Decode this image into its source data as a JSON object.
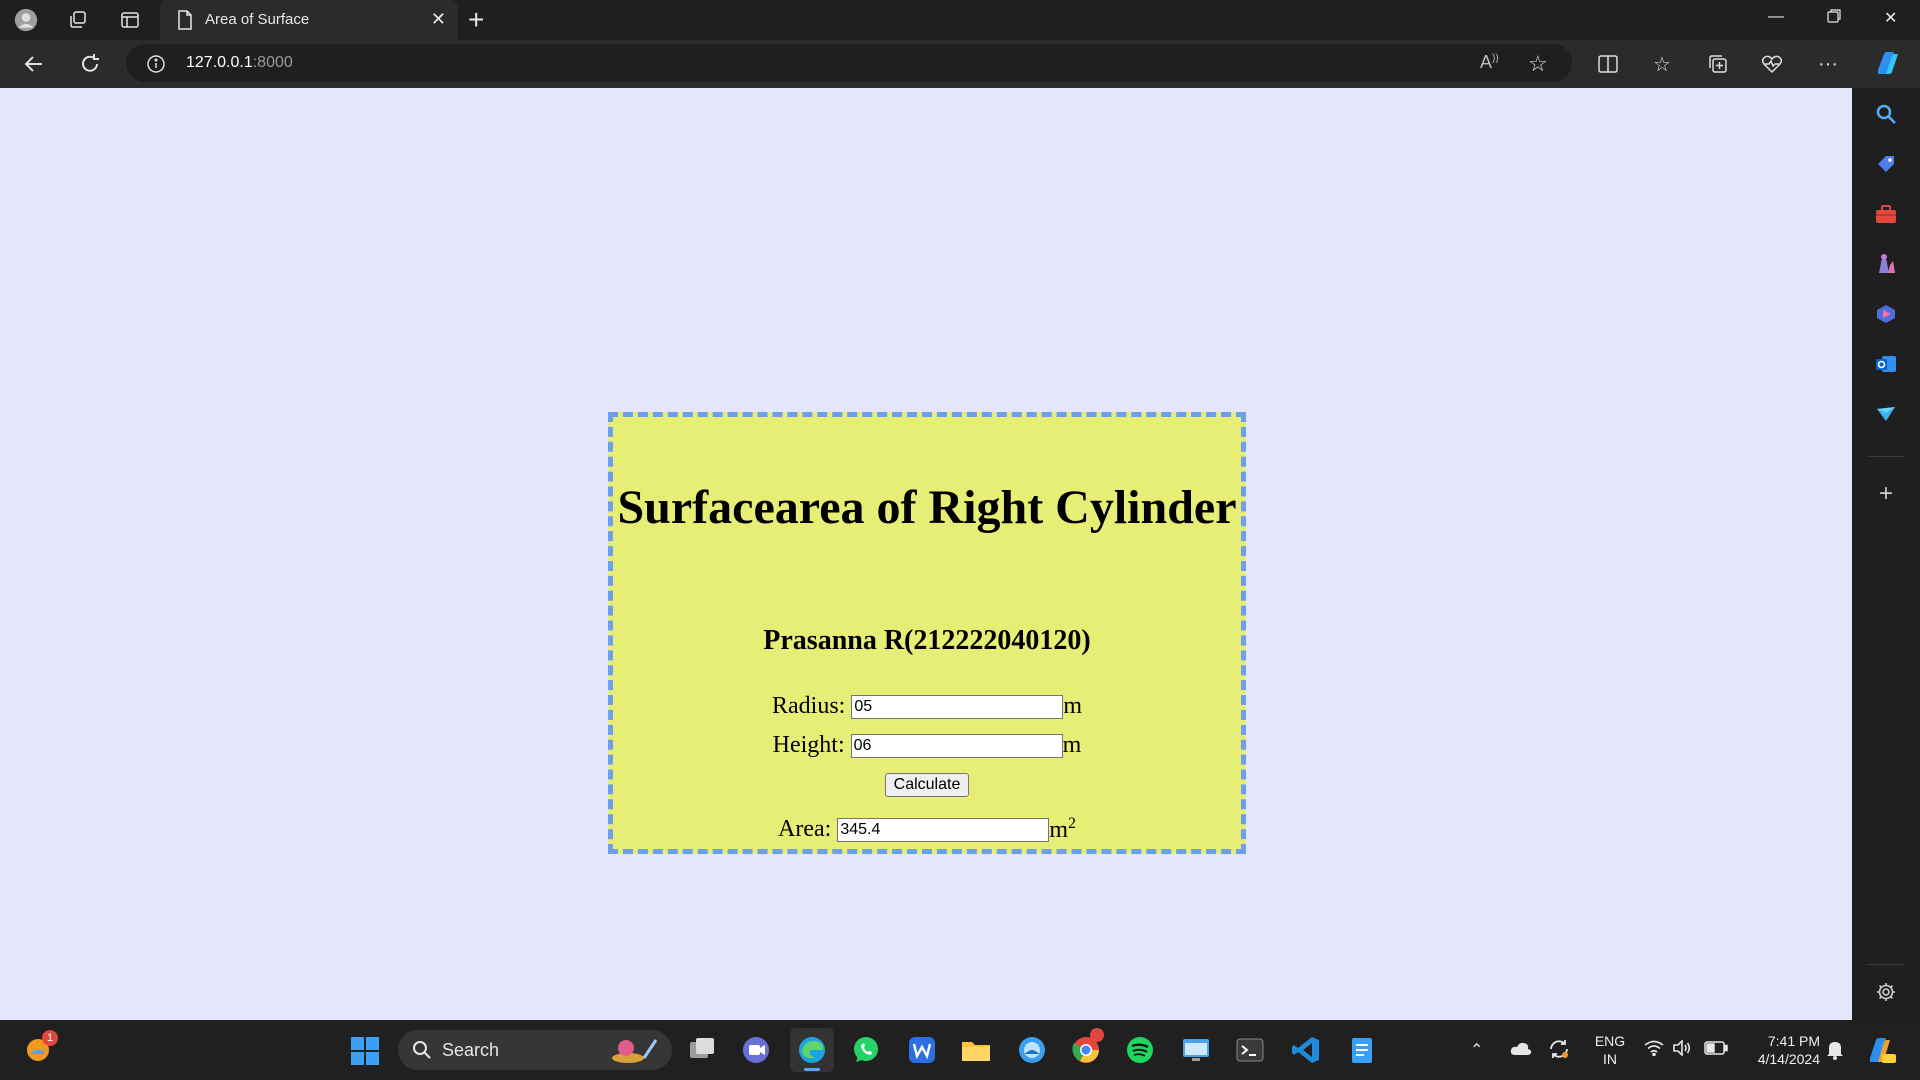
{
  "browser": {
    "tab_title": "Area of Surface",
    "url_host": "127.0.0.1",
    "url_port": ":8000"
  },
  "page": {
    "heading": "Surfacearea of Right Cylinder",
    "author": "Prasanna R(212222040120)",
    "radius_label": "Radius:",
    "radius_value": "05",
    "height_label": "Height:",
    "height_value": "06",
    "unit_m": "m",
    "calculate_label": "Calculate",
    "area_label": "Area:",
    "area_value": "345.4",
    "area_unit": "m",
    "area_exp": "2"
  },
  "taskbar": {
    "search_label": "Search",
    "lang_line1": "ENG",
    "lang_line2": "IN",
    "time": "7:41 PM",
    "date": "4/14/2024",
    "weather_badge": "1"
  },
  "colors": {
    "page_bg": "#e6e6fa",
    "card_bg": "#e6ee76",
    "card_border": "#6e9ef0"
  }
}
